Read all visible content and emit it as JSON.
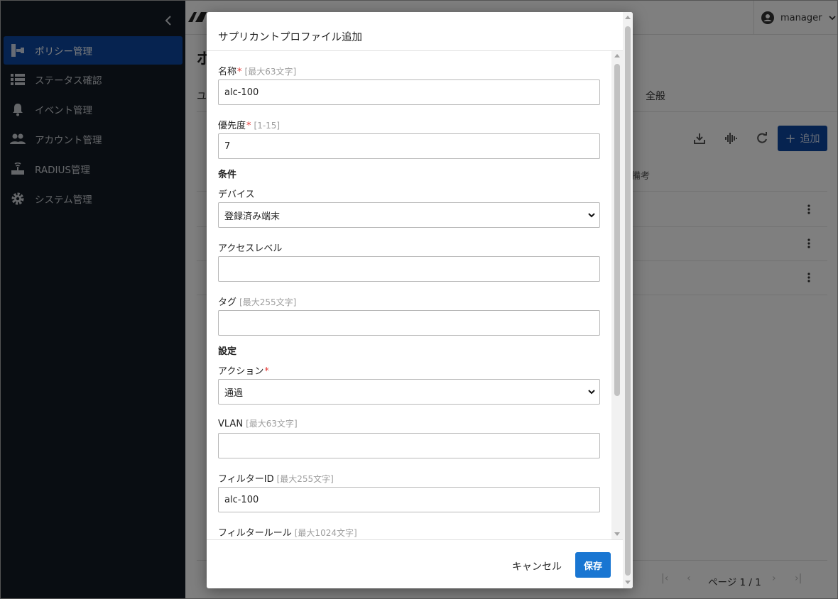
{
  "sidebar": {
    "items": [
      {
        "label": "ポリシー管理",
        "icon": "policy-icon",
        "active": true
      },
      {
        "label": "ステータス確認",
        "icon": "list-icon"
      },
      {
        "label": "イベント管理",
        "icon": "bell-icon"
      },
      {
        "label": "アカウント管理",
        "icon": "people-icon"
      },
      {
        "label": "RADIUS管理",
        "icon": "router-icon"
      },
      {
        "label": "システム管理",
        "icon": "gear-icon"
      }
    ]
  },
  "header": {
    "user": "manager"
  },
  "main": {
    "title_fragment": "ポ",
    "tab_fragment": "ユ",
    "tab_general": "全般",
    "add_label": "追加",
    "column_fragment": "備考",
    "pager_text": "ページ 1 / 1"
  },
  "dialog": {
    "title": "サプリカントプロファイル追加",
    "name": {
      "label": "名称",
      "hint": "[最大63文字]",
      "value": "alc-100"
    },
    "priority": {
      "label": "優先度",
      "hint": "[1-15]",
      "value": "7"
    },
    "conditions_heading": "条件",
    "device": {
      "label": "デバイス",
      "value": "登録済み端末"
    },
    "access_level": {
      "label": "アクセスレベル",
      "value": ""
    },
    "tag": {
      "label": "タグ",
      "hint": "[最大255文字]",
      "value": ""
    },
    "settings_heading": "設定",
    "action": {
      "label": "アクション",
      "value": "通過"
    },
    "vlan": {
      "label": "VLAN",
      "hint": "[最大63文字]",
      "value": ""
    },
    "filter_id": {
      "label": "フィルターID",
      "hint": "[最大255文字]",
      "value": "alc-100"
    },
    "filter_rule": {
      "label": "フィルタールール",
      "hint": "[最大1024文字]"
    },
    "cancel_label": "キャンセル",
    "save_label": "保存",
    "required_mark": "*"
  },
  "colors": {
    "sidebar_bg": "#131a24",
    "active": "#0d47a1",
    "primary": "#1976d2",
    "required": "#e53935"
  }
}
